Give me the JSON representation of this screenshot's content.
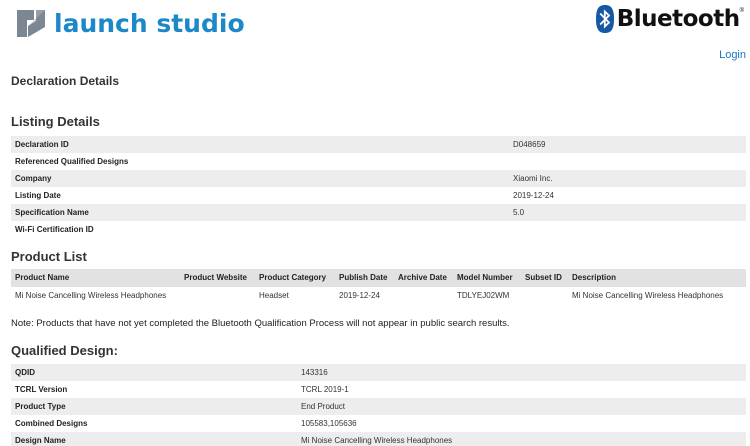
{
  "header": {
    "logo_text": "launch studio",
    "brand_text": "Bluetooth",
    "brand_mark": "®",
    "login_label": "Login",
    "colors": {
      "logo_blue": "#1c88c9",
      "logo_gray": "#7b8793",
      "bt_blue": "#1758a6"
    }
  },
  "page": {
    "title": "Declaration Details"
  },
  "listing": {
    "title": "Listing Details",
    "rows": [
      {
        "key": "Declaration ID",
        "value": "D048659"
      },
      {
        "key": "Referenced Qualified Designs",
        "value": ""
      },
      {
        "key": "Company",
        "value": "Xiaomi Inc."
      },
      {
        "key": "Listing Date",
        "value": "2019-12-24"
      },
      {
        "key": "Specification Name",
        "value": "5.0"
      },
      {
        "key": "Wi-Fi Certification ID",
        "value": ""
      }
    ]
  },
  "product_list": {
    "title": "Product List",
    "columns": [
      "Product Name",
      "Product Website",
      "Product Category",
      "Publish Date",
      "Archive Date",
      "Model Number",
      "Subset ID",
      "Description"
    ],
    "rows": [
      [
        "Mi Noise Cancelling Wireless Headphones",
        "",
        "Headset",
        "2019-12-24",
        "",
        "TDLYEJ02WM",
        "",
        "Mi Noise Cancelling Wireless Headphones"
      ]
    ],
    "note": "Note: Products that have not yet completed the Bluetooth Qualification Process will not appear in public search results."
  },
  "qualified": {
    "title": "Qualified Design:",
    "rows": [
      {
        "key": "QDID",
        "value": "143316"
      },
      {
        "key": "TCRL Version",
        "value": "TCRL 2019-1"
      },
      {
        "key": "Product Type",
        "value": "End Product"
      },
      {
        "key": "Combined Designs",
        "value": "105583,105636"
      },
      {
        "key": "Design Name",
        "value": "Mi Noise Cancelling Wireless Headphones"
      }
    ]
  }
}
